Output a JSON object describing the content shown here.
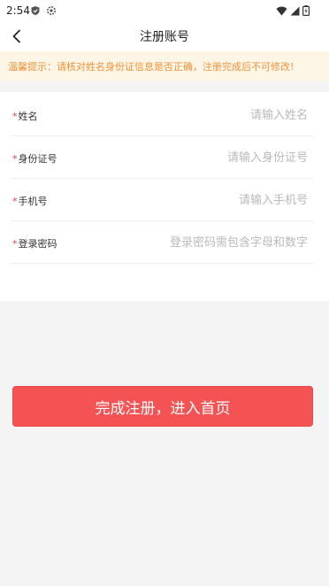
{
  "status_bar": {
    "time": "2:54",
    "icons_left": [
      "shield-icon",
      "settings-icon"
    ],
    "icons_right": [
      "wifi-icon",
      "signal-icon",
      "battery-icon"
    ]
  },
  "nav": {
    "back_icon": "chevron-left-icon",
    "title": "注册账号"
  },
  "notice": {
    "text": "温馨提示：请核对姓名身份证信息是否正确，注册完成后不可修改!"
  },
  "form": {
    "required_mark": "*",
    "fields": [
      {
        "label": "姓名",
        "placeholder": "请输入姓名",
        "value": ""
      },
      {
        "label": "身份证号",
        "placeholder": "请输入身份证号",
        "value": ""
      },
      {
        "label": "手机号",
        "placeholder": "请输入手机号",
        "value": ""
      },
      {
        "label": "登录密码",
        "placeholder": "登录密码需包含字母和数字",
        "value": ""
      }
    ]
  },
  "submit": {
    "label": "完成注册，进入首页"
  },
  "colors": {
    "accent": "#f55353",
    "notice_bg": "#fdf5e6",
    "notice_text": "#f2933a",
    "required": "#e54444",
    "page_bg": "#f4f4f4"
  }
}
